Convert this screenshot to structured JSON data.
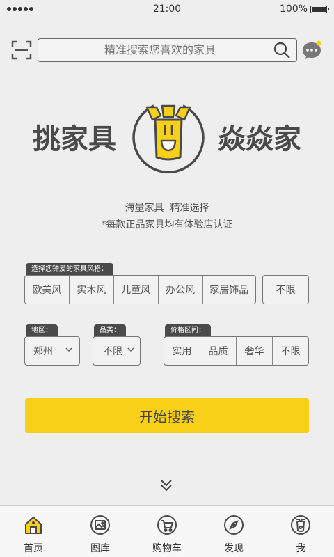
{
  "status_bar": {
    "time": "21:00",
    "battery": "100%"
  },
  "search": {
    "placeholder": "精准搜索您喜欢的家具"
  },
  "logo": {
    "left_text": "挑家具",
    "right_text": "焱焱家"
  },
  "slogan": {
    "line1": "海量家具  精准选择",
    "line2": "*每款正品家具均有体验店认证"
  },
  "style_filter": {
    "label": "选择您钟爱的家具风格：",
    "options": [
      "欧美风",
      "实木风",
      "儿童风",
      "办公风",
      "家居饰品"
    ],
    "unlimited": "不限"
  },
  "region_filter": {
    "label": "地区：",
    "value": "郑州"
  },
  "category_filter": {
    "label": "品类：",
    "value": "不限"
  },
  "price_filter": {
    "label": "价格区间：",
    "options": [
      "实用",
      "品质",
      "奢华",
      "不限"
    ]
  },
  "search_button": "开始搜索",
  "nav": {
    "items": [
      "首页",
      "图库",
      "购物车",
      "发现",
      "我"
    ]
  },
  "colors": {
    "accent": "#f8d018",
    "dark": "#4a4a4a"
  }
}
